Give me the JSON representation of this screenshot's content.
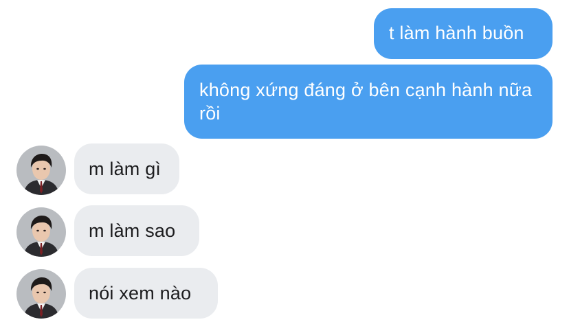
{
  "conversation": {
    "messages": [
      {
        "direction": "outgoing",
        "text": "t làm hành buồn"
      },
      {
        "direction": "outgoing",
        "text": "không xứng đáng ở bên cạnh hành nữa rồi"
      },
      {
        "direction": "incoming",
        "text": "m làm gì"
      },
      {
        "direction": "incoming",
        "text": "m làm sao"
      },
      {
        "direction": "incoming",
        "text": "nói xem nào"
      }
    ]
  },
  "colors": {
    "outgoing_bubble": "#4a9ff0",
    "incoming_bubble": "#eaecef",
    "background": "#ffffff"
  },
  "avatar": {
    "icon": "user-photo-avatar"
  }
}
